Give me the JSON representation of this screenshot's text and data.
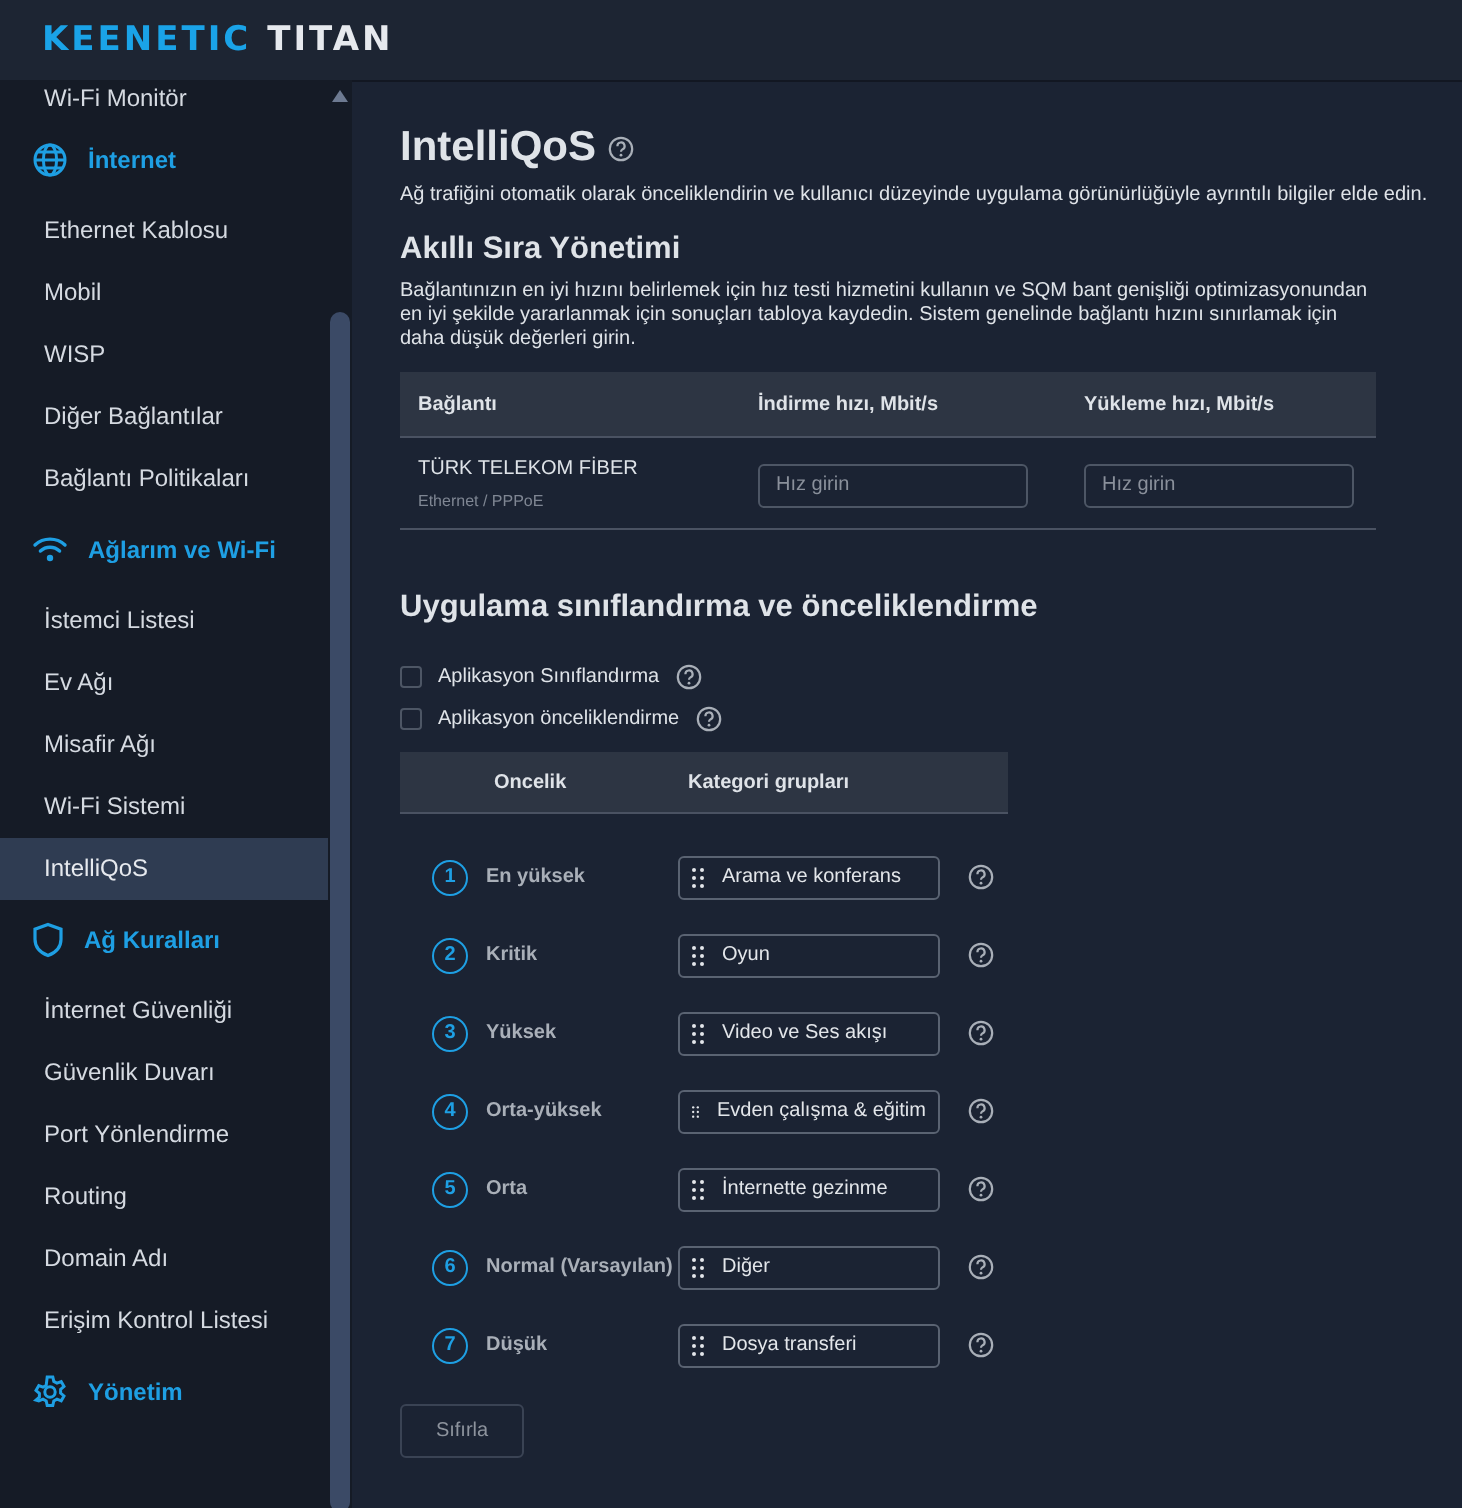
{
  "header": {
    "brand": "KEENETIC",
    "model": "TITAN"
  },
  "sidebar": {
    "items": [
      {
        "kind": "item",
        "label": "Wi-Fi Monitör",
        "selected": false
      },
      {
        "kind": "section",
        "label": "İnternet"
      },
      {
        "kind": "item",
        "label": "Ethernet Kablosu",
        "selected": false
      },
      {
        "kind": "item",
        "label": "Mobil",
        "selected": false
      },
      {
        "kind": "item",
        "label": "WISP",
        "selected": false
      },
      {
        "kind": "item",
        "label": "Diğer Bağlantılar",
        "selected": false
      },
      {
        "kind": "item",
        "label": "Bağlantı Politikaları",
        "selected": false
      },
      {
        "kind": "section",
        "label": "Ağlarım ve Wi-Fi"
      },
      {
        "kind": "item",
        "label": "İstemci Listesi",
        "selected": false
      },
      {
        "kind": "item",
        "label": "Ev Ağı",
        "selected": false
      },
      {
        "kind": "item",
        "label": "Misafir Ağı",
        "selected": false
      },
      {
        "kind": "item",
        "label": "Wi-Fi Sistemi",
        "selected": false
      },
      {
        "kind": "item",
        "label": "IntelliQoS",
        "selected": true
      },
      {
        "kind": "section",
        "label": "Ağ Kuralları"
      },
      {
        "kind": "item",
        "label": "İnternet Güvenliği",
        "selected": false
      },
      {
        "kind": "item",
        "label": "Güvenlik Duvarı",
        "selected": false
      },
      {
        "kind": "item",
        "label": "Port Yönlendirme",
        "selected": false
      },
      {
        "kind": "item",
        "label": "Routing",
        "selected": false
      },
      {
        "kind": "item",
        "label": "Domain Adı",
        "selected": false
      },
      {
        "kind": "item",
        "label": "Erişim Kontrol Listesi",
        "selected": false
      },
      {
        "kind": "section",
        "label": "Yönetim"
      }
    ]
  },
  "main": {
    "title": "IntelliQoS",
    "description": "Ağ trafiğini otomatik olarak önceliklendirin ve kullanıcı düzeyinde uygulama görünürlüğüyle ayrıntılı bilgiler elde edin.",
    "queue": {
      "heading": "Akıllı Sıra Yönetimi",
      "text": "Bağlantınızın en iyi hızını belirlemek için hız testi hizmetini kullanın ve SQM bant genişliği optimizasyonundan en iyi şekilde yararlanmak için sonuçları tabloya kaydedin. Sistem genelinde bağlantı hızını sınırlamak için daha düşük değerleri girin.",
      "columns": [
        "Bağlantı",
        "İndirme hızı, Mbit/s",
        "Yükleme hızı, Mbit/s"
      ],
      "rows": [
        {
          "connection": "TÜRK TELEKOM FİBER",
          "type": "Ethernet / PPPoE",
          "download": {
            "placeholder": "Hız girin"
          },
          "upload": {
            "placeholder": "Hız girin"
          }
        }
      ]
    },
    "apps": {
      "heading": "Uygulama sınıflandırma ve önceliklendirme",
      "options": [
        {
          "label": "Aplikasyon Sınıflandırma",
          "checked": false
        },
        {
          "label": "Aplikasyon önceliklendirme",
          "checked": false
        }
      ],
      "columns": [
        "Oncelik",
        "Kategori grupları"
      ],
      "priorities": [
        {
          "number": "1",
          "level": "En yüksek",
          "category": "Arama ve konferans"
        },
        {
          "number": "2",
          "level": "Kritik",
          "category": "Oyun"
        },
        {
          "number": "3",
          "level": "Yüksek",
          "category": "Video ve Ses akışı"
        },
        {
          "number": "4",
          "level": "Orta-yüksek",
          "category": "Evden çalışma & eğitim"
        },
        {
          "number": "5",
          "level": "Orta",
          "category": "İnternette gezinme"
        },
        {
          "number": "6",
          "level": "Normal (Varsayılan)",
          "category": "Diğer"
        },
        {
          "number": "7",
          "level": "Düşük",
          "category": "Dosya transferi"
        }
      ],
      "reset_button": "Sıfırla"
    }
  }
}
